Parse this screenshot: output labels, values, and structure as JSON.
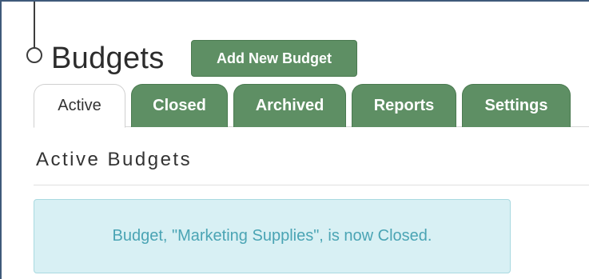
{
  "page": {
    "title": "Budgets",
    "add_button_label": "Add New Budget"
  },
  "tabs": [
    {
      "label": "Active",
      "state": "active"
    },
    {
      "label": "Closed",
      "state": "inactive"
    },
    {
      "label": "Archived",
      "state": "inactive"
    },
    {
      "label": "Reports",
      "state": "inactive"
    },
    {
      "label": "Settings",
      "state": "inactive"
    }
  ],
  "section": {
    "heading": "Active Budgets"
  },
  "alert": {
    "message": "Budget, \"Marketing Supplies\", is now Closed."
  },
  "colors": {
    "accent_green": "#5e8f64",
    "alert_bg": "#d8f0f4",
    "alert_text": "#4aa4b4",
    "frame_border": "#3f5a7a"
  },
  "icons": {
    "timeline": "timeline-node-icon"
  }
}
